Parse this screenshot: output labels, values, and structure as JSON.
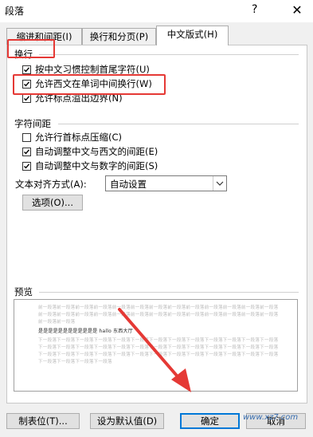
{
  "window": {
    "title": "段落",
    "help_glyph": "?",
    "close_glyph": "✕"
  },
  "tabs": [
    {
      "label": "缩进和间距(I)",
      "active": false
    },
    {
      "label": "换行和分页(P)",
      "active": false
    },
    {
      "label": "中文版式(H)",
      "active": true
    }
  ],
  "line_break": {
    "heading": "换行",
    "options": [
      {
        "label": "按中文习惯控制首尾字符(U)",
        "checked": true
      },
      {
        "label": "允许西文在单词中间换行(W)",
        "checked": true
      },
      {
        "label": "允许标点溢出边界(N)",
        "checked": true
      }
    ]
  },
  "char_spacing": {
    "heading": "字符间距",
    "options": [
      {
        "label": "允许行首标点压缩(C)",
        "checked": false
      },
      {
        "label": "自动调整中文与西文的间距(E)",
        "checked": true
      },
      {
        "label": "自动调整中文与数字的间距(S)",
        "checked": true
      }
    ],
    "align_label": "文本对齐方式(A):",
    "align_value": "自动设置",
    "options_button": "选项(O)..."
  },
  "preview": {
    "heading": "预览",
    "line_prev": "前一段落前一段落前一段落前一段落前一段落前一段落前一段落前一段落前一段落前一段落前一段落前一段落前一段落",
    "line_prev_short": "前一段落前一段落",
    "main_text": "是是是是是是是是是是是是 hallo 东西大厅",
    "line_next": "下一段落下一段落下一段落下一段落下一段落下一段落下一段落下一段落下一段落下一段落下一段落下一段落下一段落",
    "line_next_short": "下一段落下一段落下一段落下一段落"
  },
  "footer": {
    "tabs_button": "制表位(T)...",
    "default_button": "设为默认值(D)",
    "ok_button": "确定",
    "cancel_button": "取消"
  },
  "watermark": "www.xz7.com",
  "colors": {
    "annotation": "#e53935",
    "accent": "#0078d7"
  }
}
